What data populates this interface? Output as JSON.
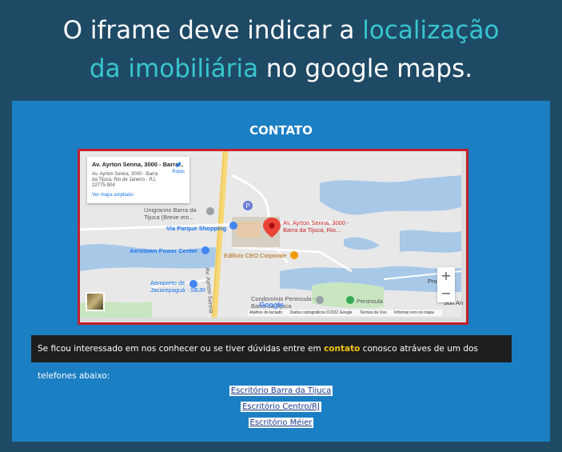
{
  "headline": {
    "line1_plain": "O iframe deve indicar a ",
    "line1_highlight": "localização",
    "line2_highlight": "da imobiliária",
    "line2_plain": " no google maps."
  },
  "section_title": "CONTATO",
  "map": {
    "info_card": {
      "title": "Av. Ayrton Senna, 3000 - Barra...",
      "address": "Av. Ayrton Senna, 3000 - Barra da Tijuca, Rio de Janeiro - RJ, 22775-904",
      "directions_label": "Rotas",
      "enlarge_link": "Ver mapa ampliado"
    },
    "places": {
      "unigranrio": "Unigranrio Barra da Tijuca (Breve em...",
      "via_parque": "Via Parque Shopping",
      "aerotown": "Aerotown Power Center",
      "marker_label": "Av. Ayrton Senna, 3000 - Barra da Tijuca, Rio...",
      "edificio": "Edifício CEO Corporate",
      "aeroporto": "Aeroporto de Jacarepaguá - SBJR",
      "road": "Av. Ayrton Senna",
      "condominio": "Condomínio Peninsula - Barra da Tijuca",
      "peninsula": "Peninsula",
      "partial_right_1": "Pro",
      "partial_right_2": "Sun An"
    },
    "zoom_in": "+",
    "zoom_out": "−",
    "google_logo": "Google",
    "attribution": {
      "shortcuts": "Atalhos do teclado",
      "map_data": "Dados cartográficos ©2022 Google",
      "terms": "Termos de Uso",
      "report": "Informar erro no mapa"
    },
    "colors": {
      "water": "#a8c8e8",
      "land": "#e8e8e8",
      "green": "#c8e6c0",
      "road": "#ffffff",
      "highway": "#f8d775",
      "marker": "#ea4335",
      "poi_blue": "#4285f4",
      "poi_orange": "#f29900"
    }
  },
  "message": {
    "before": "Se ficou interessado em nos conhecer ou se tiver dúvidas entre em ",
    "highlight": "contato",
    "after": " conosco atráves de um dos telefones abaixo:"
  },
  "offices": [
    "Escritório Barra da Tijuca",
    "Escritório Centro/RJ",
    "Escritório Méier"
  ],
  "colors": {
    "page_bg": "#1f4a66",
    "accent": "#37c6cf",
    "panel_bg": "#1b7fc4",
    "frame_border": "#c3212b",
    "message_bg": "#1e1e1e",
    "message_highlight": "#f2c811"
  }
}
